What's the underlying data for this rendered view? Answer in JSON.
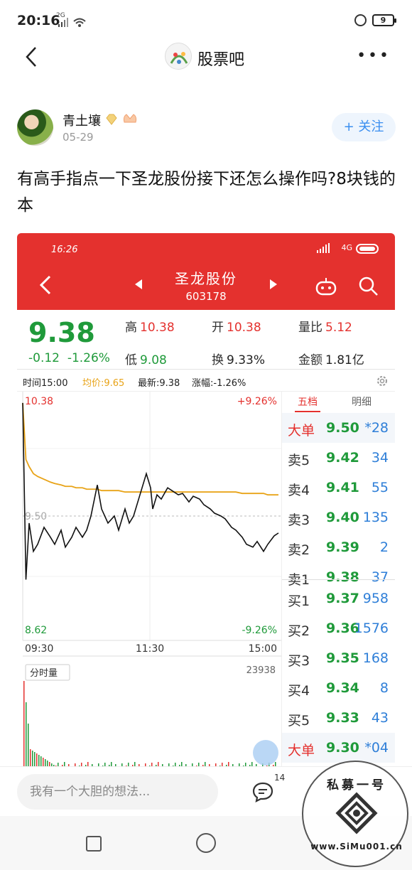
{
  "status_bar": {
    "time": "20:16",
    "network": "2G",
    "battery": "9"
  },
  "nav": {
    "title": "股票吧"
  },
  "post": {
    "author": "青土壤",
    "date": "05-29",
    "follow_label": "+ 关注",
    "title": "有高手指点一下圣龙股份接下还怎么操作吗?8块钱的本"
  },
  "screenshot": {
    "time": "16:26",
    "network": "4G",
    "stock_name": "圣龙股份",
    "stock_code": "603178",
    "price": "9.38",
    "change": "-0.12",
    "change_pct": "-1.26%",
    "stats": [
      {
        "label": "高",
        "value": "10.38",
        "color": "red"
      },
      {
        "label": "开",
        "value": "10.38",
        "color": "red"
      },
      {
        "label": "量比",
        "value": "5.12",
        "color": "red"
      },
      {
        "label": "低",
        "value": "9.08",
        "color": "green"
      },
      {
        "label": "换",
        "value": "9.33%",
        "color": "dark"
      },
      {
        "label": "金额",
        "value": "1.81亿",
        "color": "dark"
      }
    ],
    "chart_info": {
      "time_label": "时间15:00",
      "avg_label": "均价:9.65",
      "latest_label": "最新:9.38",
      "change_label": "涨幅:-1.26%"
    },
    "orderbook_tabs": [
      "五档",
      "明细"
    ],
    "orderbook": [
      {
        "label": "大单",
        "price": "9.50",
        "vol": "*28",
        "kind": "dan"
      },
      {
        "label": "卖5",
        "price": "9.42",
        "vol": "34",
        "kind": "sell"
      },
      {
        "label": "卖4",
        "price": "9.41",
        "vol": "55",
        "kind": "sell"
      },
      {
        "label": "卖3",
        "price": "9.40",
        "vol": "135",
        "kind": "sell"
      },
      {
        "label": "卖2",
        "price": "9.39",
        "vol": "2",
        "kind": "sell"
      },
      {
        "label": "卖1",
        "price": "9.38",
        "vol": "37",
        "kind": "sell"
      },
      {
        "label": "买1",
        "price": "9.37",
        "vol": "958",
        "kind": "buy"
      },
      {
        "label": "买2",
        "price": "9.36",
        "vol": "1576",
        "kind": "buy"
      },
      {
        "label": "买3",
        "price": "9.35",
        "vol": "168",
        "kind": "buy"
      },
      {
        "label": "买4",
        "price": "9.34",
        "vol": "8",
        "kind": "buy"
      },
      {
        "label": "买5",
        "price": "9.33",
        "vol": "43",
        "kind": "buy"
      },
      {
        "label": "大单",
        "price": "9.30",
        "vol": "*04",
        "kind": "dan"
      }
    ],
    "volume_label": "分时量",
    "volume_max": "23938"
  },
  "chart_data": {
    "type": "line",
    "title": "",
    "xlabel": "",
    "ylabel": "",
    "ylim": [
      8.62,
      10.38
    ],
    "y_tick_labels": [
      "10.38",
      "9.50",
      "8.62"
    ],
    "pct_tick_labels": [
      "+9.26%",
      "-9.26%"
    ],
    "x_tick_labels": [
      "09:30",
      "11:30",
      "15:00"
    ],
    "x": [
      0,
      3,
      6,
      10,
      14,
      20,
      26,
      30,
      36,
      40,
      46,
      50,
      56,
      60,
      64,
      70,
      74,
      80,
      86,
      90,
      96,
      100,
      104,
      110,
      116,
      120,
      122,
      126,
      130,
      136,
      140,
      146,
      150,
      156,
      160,
      166,
      170,
      176,
      180,
      186,
      190,
      196,
      200,
      206,
      210,
      216,
      220,
      226,
      230,
      236,
      240
    ],
    "series": [
      {
        "values": [
          10.3,
          9.05,
          9.45,
          9.25,
          9.3,
          9.42,
          9.35,
          9.3,
          9.4,
          9.28,
          9.35,
          9.42,
          9.35,
          9.4,
          9.5,
          9.72,
          9.55,
          9.45,
          9.5,
          9.4,
          9.55,
          9.45,
          9.5,
          9.65,
          9.8,
          9.7,
          9.55,
          9.65,
          9.62,
          9.7,
          9.68,
          9.65,
          9.66,
          9.6,
          9.64,
          9.62,
          9.58,
          9.55,
          9.52,
          9.5,
          9.48,
          9.42,
          9.4,
          9.35,
          9.3,
          9.28,
          9.32,
          9.25,
          9.3,
          9.36,
          9.38
        ]
      },
      {
        "values": [
          10.3,
          9.9,
          9.85,
          9.8,
          9.78,
          9.76,
          9.74,
          9.73,
          9.72,
          9.71,
          9.71,
          9.7,
          9.7,
          9.69,
          9.69,
          9.69,
          9.68,
          9.68,
          9.68,
          9.68,
          9.67,
          9.67,
          9.67,
          9.67,
          9.67,
          9.67,
          9.67,
          9.67,
          9.67,
          9.67,
          9.67,
          9.67,
          9.67,
          9.67,
          9.67,
          9.67,
          9.67,
          9.67,
          9.67,
          9.67,
          9.67,
          9.67,
          9.67,
          9.66,
          9.66,
          9.66,
          9.66,
          9.66,
          9.65,
          9.65,
          9.65
        ]
      }
    ],
    "prev_close": 9.5
  },
  "comment_bar": {
    "placeholder": "我有一个大胆的想法...",
    "comment_count": "14"
  },
  "watermark": {
    "top_text": "私募一号",
    "bottom_text": "www.SiMu001.cn"
  },
  "colors": {
    "red": "#e4312e",
    "green": "#1f9a3a",
    "blue": "#2f7fd8",
    "accent": "#3a8ef0",
    "avg_line": "#e8a317"
  }
}
